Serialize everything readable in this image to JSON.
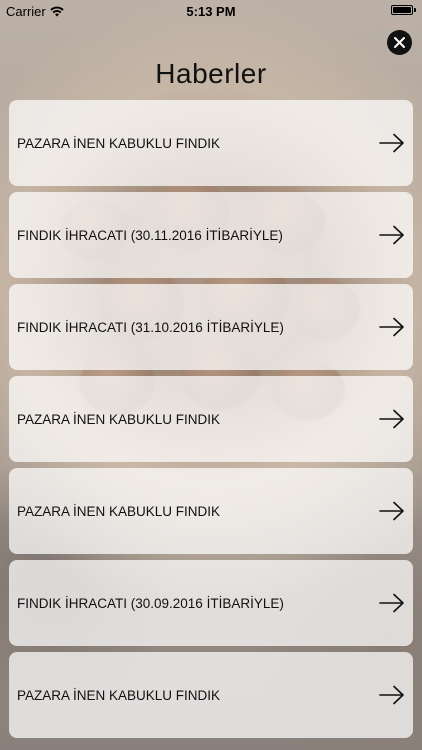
{
  "status_bar": {
    "carrier": "Carrier",
    "time": "5:13 PM",
    "battery_level": 1.0
  },
  "header": {
    "title": "Haberler"
  },
  "news": {
    "items": [
      {
        "label": "PAZARA İNEN KABUKLU FINDIK"
      },
      {
        "label": "FINDIK İHRACATI (30.11.2016 İTİBARİYLE)"
      },
      {
        "label": "FINDIK İHRACATI (31.10.2016 İTİBARİYLE)"
      },
      {
        "label": "PAZARA İNEN KABUKLU FINDIK"
      },
      {
        "label": "PAZARA İNEN KABUKLU FINDIK"
      },
      {
        "label": "FINDIK İHRACATI (30.09.2016 İTİBARİYLE)"
      },
      {
        "label": "PAZARA İNEN KABUKLU FINDIK"
      }
    ]
  },
  "icons": {
    "close": "close-icon",
    "arrow": "arrow-right-icon",
    "wifi": "wifi-icon",
    "battery": "battery-icon"
  }
}
